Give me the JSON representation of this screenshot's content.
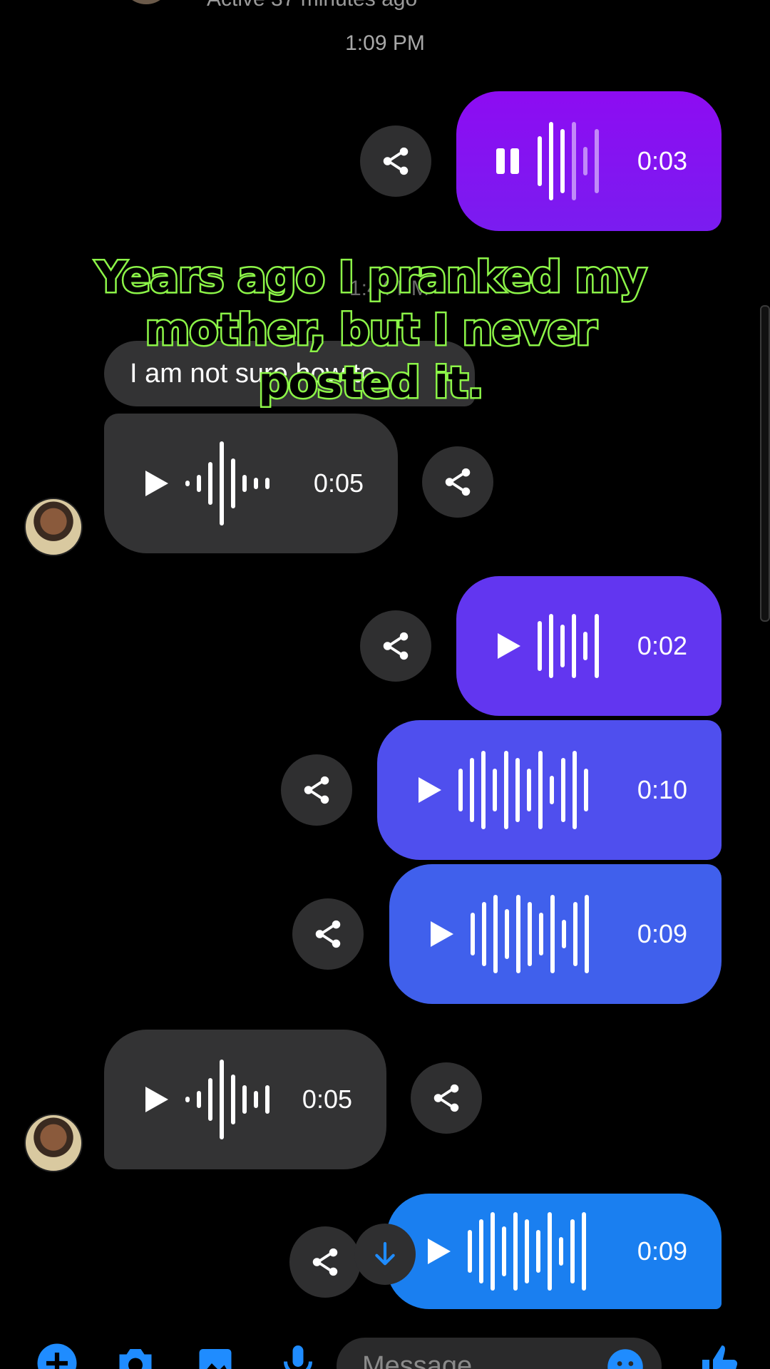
{
  "header": {
    "active_status": "Active 37 minutes ago",
    "timestamp": "1:09 PM"
  },
  "caption": {
    "line1": "Years ago I pranked my",
    "line2": "mother, but I never",
    "line3": "posted it."
  },
  "messages": {
    "out_audio_1": {
      "duration": "0:03",
      "state": "playing"
    },
    "faded_time": "1:44 PM",
    "in_text": "I am not sure how to",
    "in_audio_1": {
      "duration": "0:05"
    },
    "out_audio_2": {
      "duration": "0:02"
    },
    "out_audio_3": {
      "duration": "0:10"
    },
    "out_audio_4": {
      "duration": "0:09"
    },
    "in_audio_2": {
      "duration": "0:05"
    },
    "out_audio_5": {
      "duration": "0:09"
    }
  },
  "composer": {
    "placeholder": "Message"
  },
  "colors": {
    "out_1": "#8a10f0",
    "out_2": "#6438f0",
    "out_3": "#4f50ee",
    "out_4": "#4360ec",
    "out_5": "#1a7ff0",
    "incoming": "#333334",
    "caption_stroke": "#8cf548",
    "accent": "#1f8cff"
  }
}
